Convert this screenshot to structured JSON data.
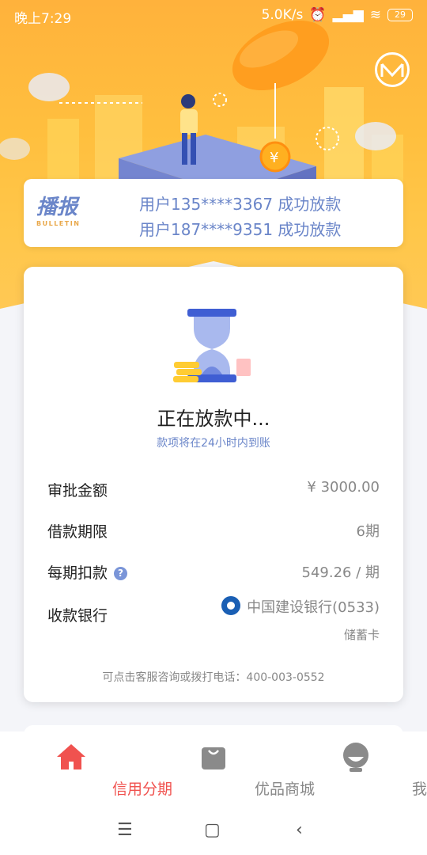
{
  "status_bar": {
    "time": "晚上7:29",
    "network_speed": "5.0K/s",
    "battery": "29"
  },
  "bulletin": {
    "title": "播报",
    "subtitle": "BULLETIN",
    "lines": [
      "用户135****3367 成功放款",
      "用户187****9351 成功放款"
    ]
  },
  "status": {
    "title": "正在放款中...",
    "subtitle": "款项将在24小时内到账"
  },
  "details": {
    "amount": {
      "label": "审批金额",
      "value": "¥ 3000.00"
    },
    "term": {
      "label": "借款期限",
      "value": "6期"
    },
    "installment": {
      "label": "每期扣款",
      "help": "?",
      "value": "549.26 / 期"
    },
    "bank": {
      "label": "收款银行",
      "value": "中国建设银行(0533)",
      "type": "储蓄卡"
    }
  },
  "footer_note": "可点击客服咨询或拨打电话：400-003-0552",
  "tabbar": {
    "tabs": [
      {
        "label": "信用分期",
        "icon": "home-icon",
        "active": true
      },
      {
        "label": "优品商城",
        "icon": "shopping-bag-icon",
        "active": false
      },
      {
        "label": "我的",
        "icon": "profile-icon",
        "active": false
      }
    ]
  },
  "colors": {
    "accent": "#f0524f",
    "brand_blue": "#6b86c9",
    "hero_orange": "#ffb23c"
  }
}
